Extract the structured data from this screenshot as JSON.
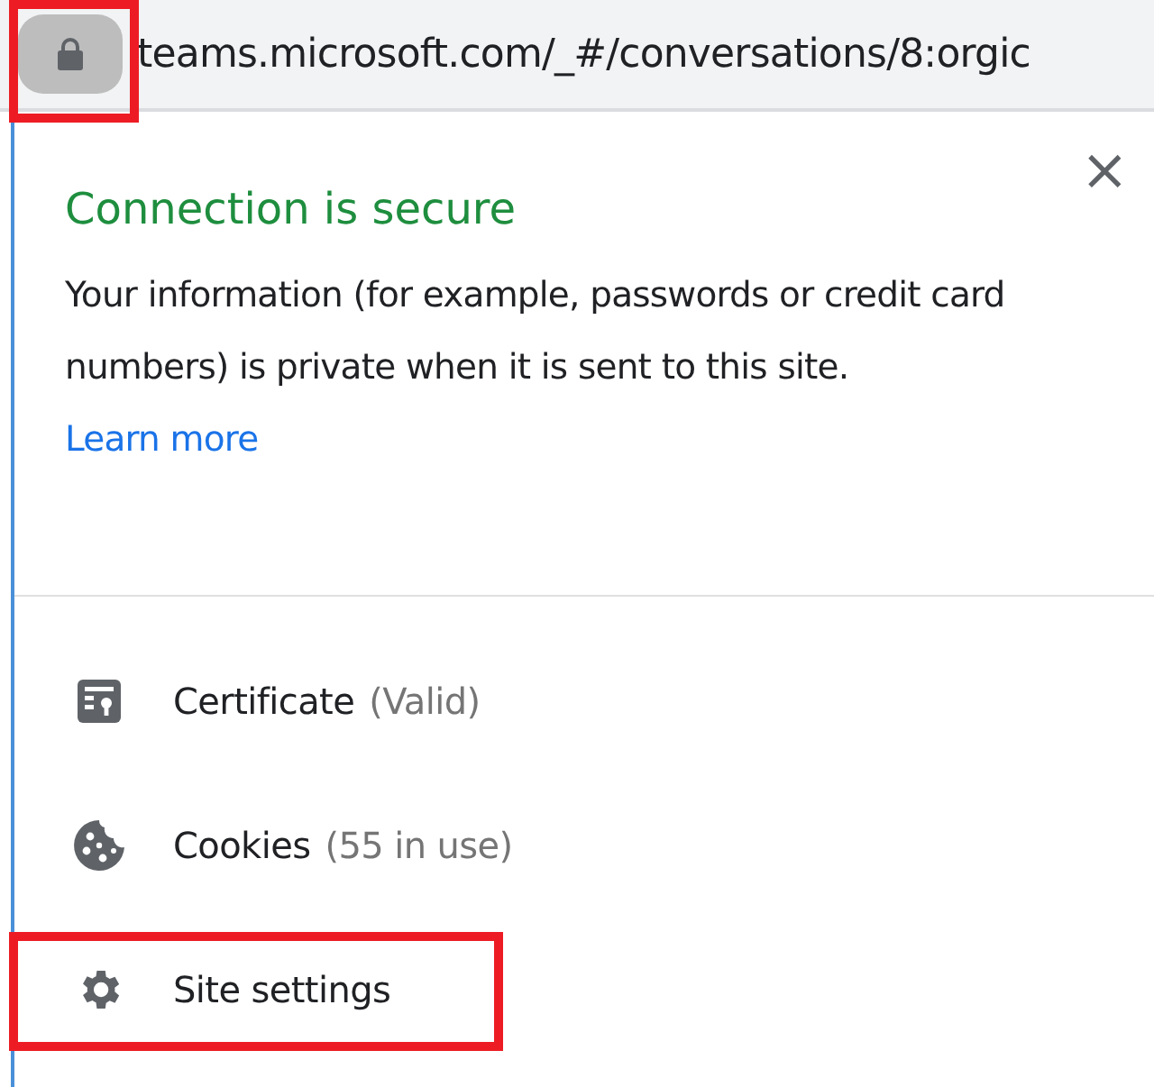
{
  "address_bar": {
    "url": "teams.microsoft.com/_#/conversations/8:orgic",
    "lock_highlighted": true
  },
  "popup": {
    "title": "Connection is secure",
    "description": "Your information (for example, passwords or credit card numbers) is private when it is sent to this site.",
    "link": "Learn more",
    "close": "×",
    "items": [
      {
        "kind": "certificate",
        "label": "Certificate",
        "detail": "(Valid)",
        "highlighted": false
      },
      {
        "kind": "cookies",
        "label": "Cookies",
        "detail": "(55 in use)",
        "highlighted": false
      },
      {
        "kind": "settings",
        "label": "Site settings",
        "highlighted": true
      }
    ]
  }
}
